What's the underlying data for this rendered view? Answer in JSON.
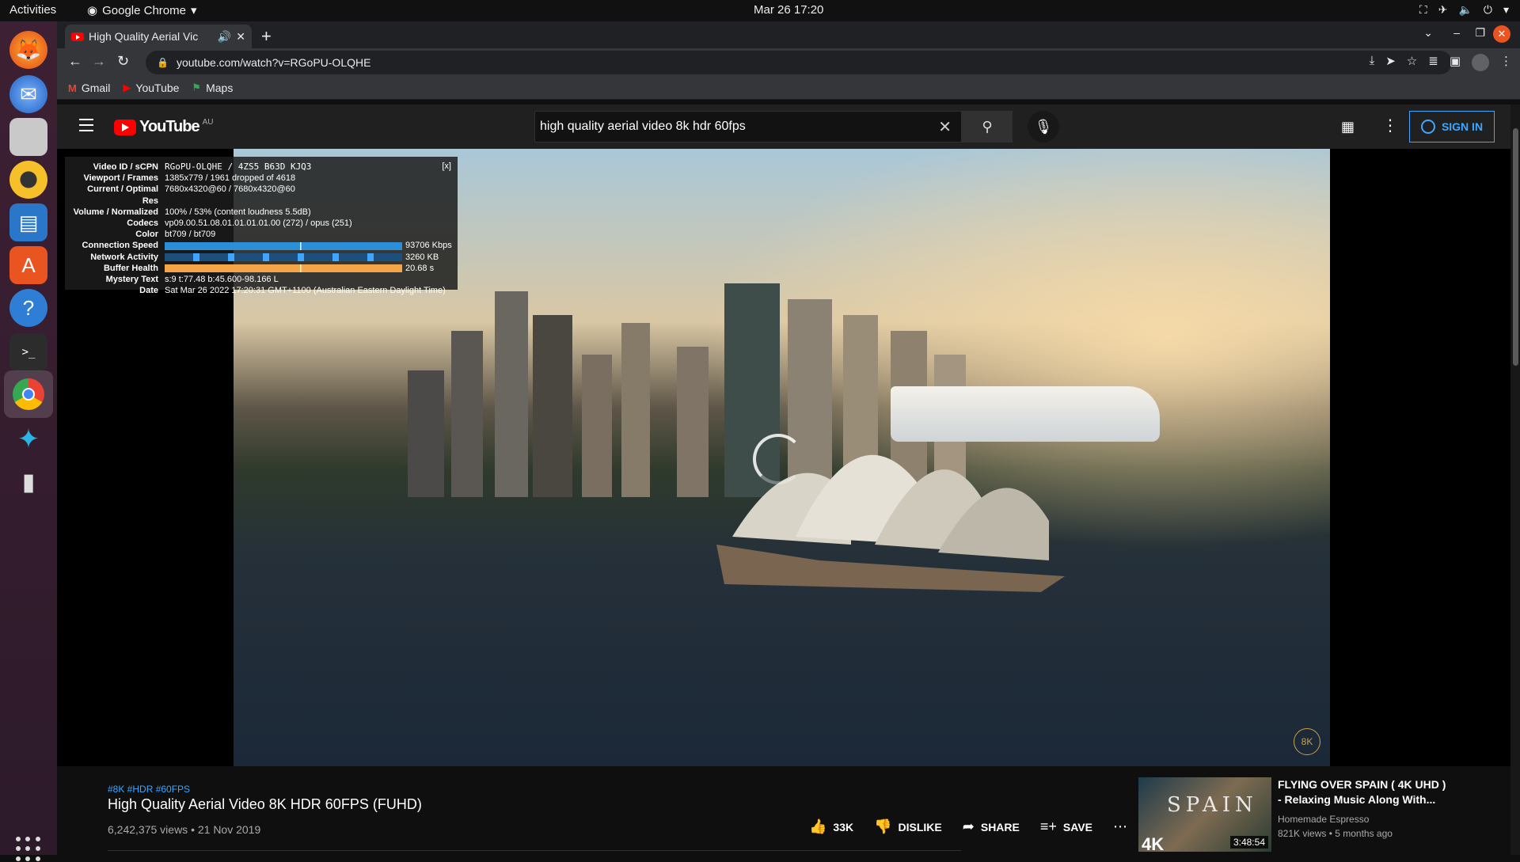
{
  "gnome": {
    "activities": "Activities",
    "app_name": "Google Chrome",
    "clock": "Mar 26  17:20"
  },
  "dock": {
    "items": [
      "firefox-icon",
      "thunderbird-icon",
      "files-icon",
      "rhythmbox-icon",
      "libreoffice-writer-icon",
      "app-center-icon",
      "help-icon",
      "terminal-icon",
      "chrome-icon",
      "kodi-icon",
      "thermometer-icon"
    ]
  },
  "browser": {
    "tab_title": "High Quality Aerial Vic",
    "url": "youtube.com/watch?v=RGoPU-OLQHE",
    "bookmarks": [
      "Gmail",
      "YouTube",
      "Maps"
    ]
  },
  "youtube": {
    "logo_text": "YouTube",
    "region": "AU",
    "search_value": "high quality aerial video 8k hdr 60fps",
    "signin_label": "SIGN IN"
  },
  "stats": {
    "close": "[x]",
    "rows": [
      {
        "label": "Video ID / sCPN",
        "value": "RGoPU-OLQHE / 4ZS5 B63D KJQ3"
      },
      {
        "label": "Viewport / Frames",
        "value": "1385x779 / 1961 dropped of 4618"
      },
      {
        "label": "Current / Optimal Res",
        "value": "7680x4320@60 / 7680x4320@60"
      },
      {
        "label": "Volume / Normalized",
        "value": "100% / 53% (content loudness 5.5dB)"
      },
      {
        "label": "Codecs",
        "value": "vp09.00.51.08.01.01.01.01.00 (272) / opus (251)"
      },
      {
        "label": "Color",
        "value": "bt709 / bt709"
      },
      {
        "label": "Connection Speed",
        "value": "93706 Kbps"
      },
      {
        "label": "Network Activity",
        "value": "3260 KB"
      },
      {
        "label": "Buffer Health",
        "value": "20.68 s"
      },
      {
        "label": "Mystery Text",
        "value": "s:9 t:77.48 b:45.600-98.166 L"
      },
      {
        "label": "Date",
        "value": "Sat Mar 26 2022 17:20:31 GMT+1100 (Australian Eastern Daylight Time)"
      }
    ]
  },
  "video": {
    "watermark": "8K",
    "tags": "#8K #HDR #60FPS",
    "title": "High Quality Aerial Video 8K HDR 60FPS (FUHD)",
    "meta": "6,242,375 views • 21 Nov 2019",
    "likes": "33K",
    "dislike": "DISLIKE",
    "share": "SHARE",
    "save": "SAVE"
  },
  "recommended": {
    "title": "FLYING OVER SPAIN ( 4K UHD ) - Relaxing Music Along With...",
    "channel": "Homemade Espresso",
    "meta": "821K views • 5 months ago",
    "duration": "3:48:54",
    "thumb_text": "SPAIN",
    "thumb_badge": "4K"
  }
}
